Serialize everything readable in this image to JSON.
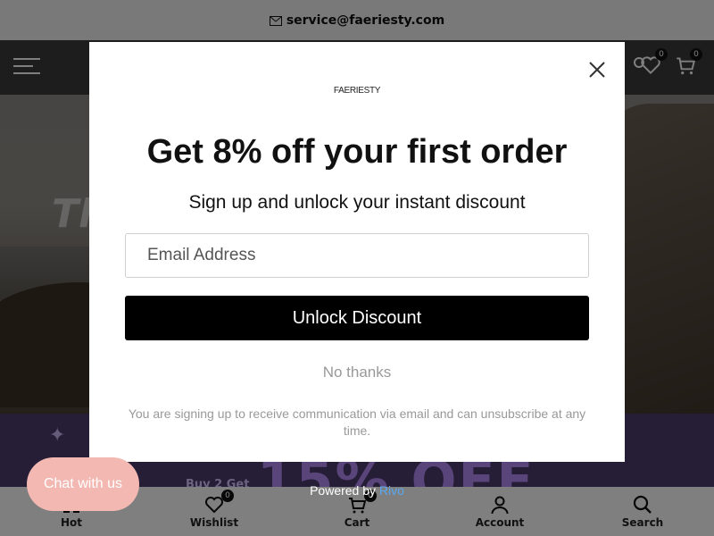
{
  "announcement": {
    "icon": "mail-icon",
    "email": "service@faeriesty.com"
  },
  "header": {
    "menu_icon": "hamburger-icon",
    "wishlist_count": "0",
    "cart_count": "0"
  },
  "hero": {
    "title": "Th"
  },
  "promo": {
    "small_text": "Buy 2 Get",
    "big_text": "15% OFF"
  },
  "popup": {
    "logo": "FAERIESTY",
    "title": "Get 8% off your first order",
    "subtitle": "Sign up and unlock your instant discount",
    "email_placeholder": "Email Address",
    "unlock_label": "Unlock Discount",
    "no_thanks_label": "No thanks",
    "disclaimer": "You are signing up to receive communication via email and can unsubscribe at any time."
  },
  "powered_by": {
    "prefix": "Powered by",
    "brand": "Rivo"
  },
  "chat": {
    "label": "Chat with us"
  },
  "bottom_nav": [
    {
      "label": "Hot",
      "icon": "grid-icon"
    },
    {
      "label": "Wishlist",
      "icon": "heart-icon",
      "badge": "0"
    },
    {
      "label": "Cart",
      "icon": "cart-icon",
      "badge": "0"
    },
    {
      "label": "Account",
      "icon": "user-icon"
    },
    {
      "label": "Search",
      "icon": "search-icon"
    }
  ],
  "colors": {
    "overlay": "#000000",
    "promo_bg": "#4c3b6e",
    "chat_bg": "#f3b8b2",
    "rivo_link": "#5aa7f0"
  }
}
